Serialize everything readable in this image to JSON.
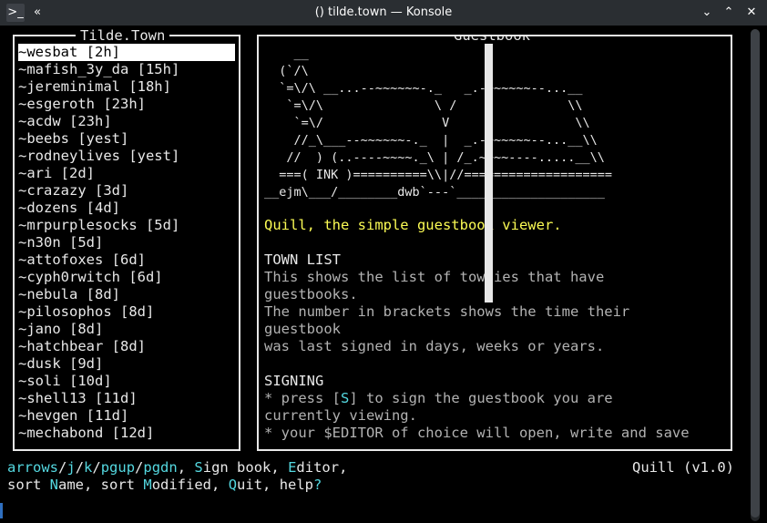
{
  "window": {
    "title": "() tilde.town — Konsole",
    "app_icon": ">_",
    "keep_above_icon": "«",
    "minimize_icon": "⌄",
    "maximize_icon": "⌃",
    "close_icon": "✕"
  },
  "left_panel": {
    "title": "Tilde.Town",
    "users": [
      "~wesbat [2h]",
      "~mafish_3y_da [15h]",
      "~jereminimal [18h]",
      "~esgeroth [23h]",
      "~acdw [23h]",
      "~beebs [yest]",
      "~rodneylives [yest]",
      "~ari [2d]",
      "~crazazy [3d]",
      "~dozens [4d]",
      "~mrpurplesocks [5d]",
      "~n30n [5d]",
      "~attofoxes [6d]",
      "~cyph0rwitch [6d]",
      "~nebula [8d]",
      "~pilosophos [8d]",
      "~jano [8d]",
      "~hatchbear [8d]",
      "~dusk [9d]",
      "~soli [10d]",
      "~shell13 [11d]",
      "~hevgen [11d]",
      "~mechabond [12d]"
    ],
    "selected_index": 0
  },
  "right_panel": {
    "title": "Guestbook",
    "ascii_art": "    __\n  (`/\\\n  `=\\/\\ __...--~~~~~~-._   _.-~~~~~~--...__\n   `=\\/\\               \\ /               \\\\\n    `=\\/                V                 \\\\\n    //_\\___--~~~~~~-._  |  _.-~~~~~~--...__\\\\\n   //  ) (..----~~~~._\\ | /_.~~~~----.....__\\\\\n  ===( INK )==========\\\\|//====================\n__ejm\\___/________dwb`---`____________________",
    "tagline": "Quill, the simple guestbook viewer.",
    "section_town_list": "TOWN LIST",
    "town_list_text": [
      "This shows the list of townies that have",
      "guestbooks.",
      "The number in brackets shows the time their",
      "guestbook",
      "was last signed in days, weeks or years."
    ],
    "section_signing": "SIGNING",
    "signing_line1": {
      "prefix": "* press [",
      "key": "S",
      "suffix": "] to sign the guestbook you are"
    },
    "signing_text": [
      "currently viewing.",
      "* your $EDITOR of choice will open, write and save"
    ]
  },
  "help_bar": {
    "line1": [
      {
        "text": "arrows",
        "c": "cyan"
      },
      {
        "text": "/",
        "c": "white"
      },
      {
        "text": "j",
        "c": "cyan"
      },
      {
        "text": "/",
        "c": "white"
      },
      {
        "text": "k",
        "c": "cyan"
      },
      {
        "text": "/",
        "c": "white"
      },
      {
        "text": "pgup",
        "c": "cyan"
      },
      {
        "text": "/",
        "c": "white"
      },
      {
        "text": "pgdn",
        "c": "cyan"
      },
      {
        "text": ", ",
        "c": "white"
      },
      {
        "text": "S",
        "c": "cyan"
      },
      {
        "text": "ign book, ",
        "c": "white"
      },
      {
        "text": "E",
        "c": "cyan"
      },
      {
        "text": "ditor,",
        "c": "white"
      }
    ],
    "line2": [
      {
        "text": "sort ",
        "c": "white"
      },
      {
        "text": "N",
        "c": "cyan"
      },
      {
        "text": "ame, sort ",
        "c": "white"
      },
      {
        "text": "M",
        "c": "cyan"
      },
      {
        "text": "odified, ",
        "c": "white"
      },
      {
        "text": "Q",
        "c": "cyan"
      },
      {
        "text": "uit, help",
        "c": "white"
      },
      {
        "text": "?",
        "c": "cyan"
      }
    ],
    "version": "Quill (v1.0)"
  }
}
